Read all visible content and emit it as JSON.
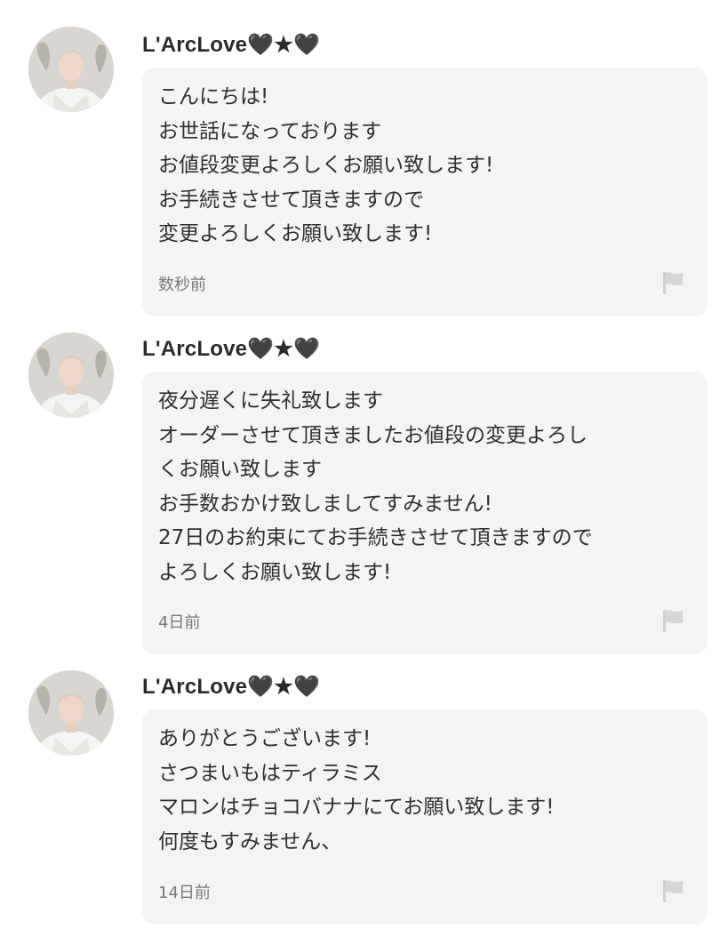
{
  "comments": [
    {
      "username": "L'ArcLove🖤★🖤",
      "message": "こんにちは!\nお世話になっております\nお値段変更よろしくお願い致します!\nお手続きさせて頂きますので\n変更よろしくお願い致します!",
      "timestamp": "数秒前"
    },
    {
      "username": "L'ArcLove🖤★🖤",
      "message": "夜分遅くに失礼致します\nオーダーさせて頂きましたお値段の変更よろし\nくお願い致します\nお手数おかけ致しましてすみません!\n27日のお約束にてお手続きさせて頂きますので\nよろしくお願い致します!",
      "timestamp": "4日前"
    },
    {
      "username": "L'ArcLove🖤★🖤",
      "message": "ありがとうございます!\nさつまいもはティラミス\nマロンはチョコバナナにてお願い致します!\n何度もすみません、",
      "timestamp": "14日前"
    }
  ],
  "icons": {
    "report": "flag-icon",
    "avatar": "user-avatar"
  },
  "colors": {
    "bubble_background": "#f4f4f4",
    "username": "#2a2a2a",
    "message_text": "#2f2f2f",
    "timestamp": "#777777",
    "flag_icon": "#d0d0d0"
  }
}
